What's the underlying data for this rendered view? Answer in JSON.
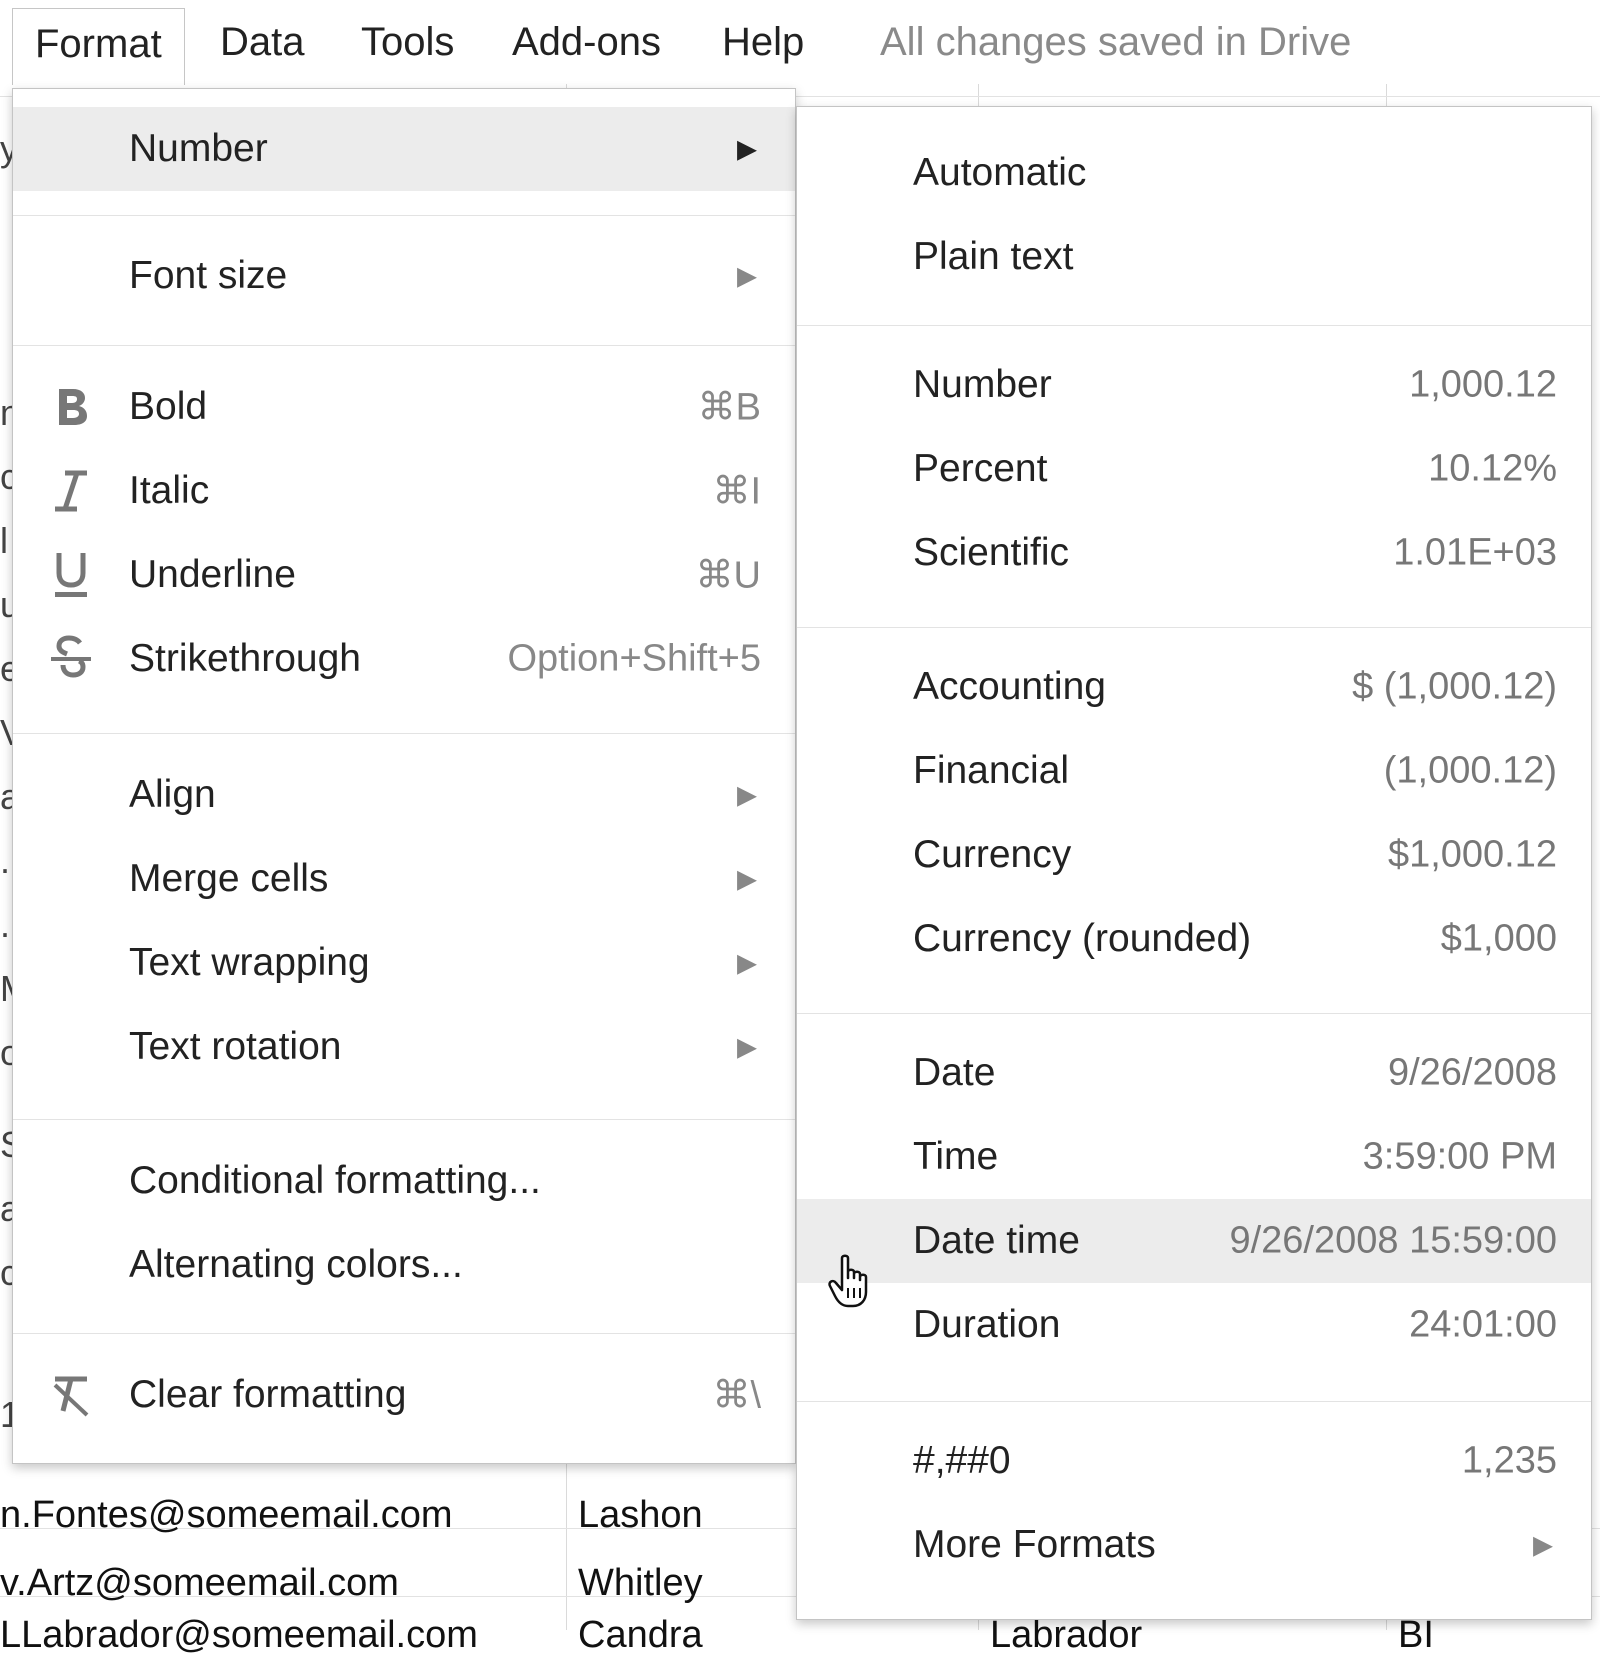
{
  "menubar": {
    "items": [
      "Format",
      "Data",
      "Tools",
      "Add-ons",
      "Help"
    ],
    "status": "All changes saved in Drive"
  },
  "format_menu": {
    "number": "Number",
    "font_size": "Font size",
    "bold": {
      "label": "Bold",
      "shortcut": "⌘B",
      "icon": "bold-icon"
    },
    "italic": {
      "label": "Italic",
      "shortcut": "⌘I",
      "icon": "italic-icon"
    },
    "underline": {
      "label": "Underline",
      "shortcut": "⌘U",
      "icon": "underline-icon"
    },
    "strikethrough": {
      "label": "Strikethrough",
      "shortcut": "Option+Shift+5",
      "icon": "strikethrough-icon"
    },
    "align": "Align",
    "merge_cells": "Merge cells",
    "text_wrapping": "Text wrapping",
    "text_rotation": "Text rotation",
    "conditional_formatting": "Conditional formatting...",
    "alternating_colors": "Alternating colors...",
    "clear_formatting": {
      "label": "Clear formatting",
      "shortcut": "⌘\\",
      "icon": "clear-formatting-icon"
    }
  },
  "number_menu": {
    "automatic": "Automatic",
    "plain_text": "Plain text",
    "number": {
      "label": "Number",
      "sample": "1,000.12"
    },
    "percent": {
      "label": "Percent",
      "sample": "10.12%"
    },
    "scientific": {
      "label": "Scientific",
      "sample": "1.01E+03"
    },
    "accounting": {
      "label": "Accounting",
      "sample": "$ (1,000.12)"
    },
    "financial": {
      "label": "Financial",
      "sample": "(1,000.12)"
    },
    "currency": {
      "label": "Currency",
      "sample": "$1,000.12"
    },
    "currency_rounded": {
      "label": "Currency (rounded)",
      "sample": "$1,000"
    },
    "date": {
      "label": "Date",
      "sample": "9/26/2008"
    },
    "time": {
      "label": "Time",
      "sample": "3:59:00 PM"
    },
    "date_time": {
      "label": "Date time",
      "sample": "9/26/2008 15:59:00"
    },
    "duration": {
      "label": "Duration",
      "sample": "24:01:00"
    },
    "custom": {
      "label": "#,##0",
      "sample": "1,235"
    },
    "more_formats": "More Formats"
  },
  "sheet": {
    "rows": [
      {
        "email": "n.Fontes@someemail.com",
        "first": "Lashon"
      },
      {
        "email": "v.Artz@someemail.com",
        "first": "Whitley"
      },
      {
        "email": "LLabrador@someemail.com",
        "first": "Candra",
        "last": "Labrador",
        "extra": "BI"
      }
    ],
    "edge_chars": [
      "y",
      "n",
      "c",
      "l",
      "u",
      "e",
      "V",
      "a",
      ".",
      ".",
      "M",
      "o",
      "S",
      "a",
      "c",
      "1"
    ]
  },
  "colors": {
    "highlight": "#ececec",
    "status": "#8a8a8a"
  }
}
